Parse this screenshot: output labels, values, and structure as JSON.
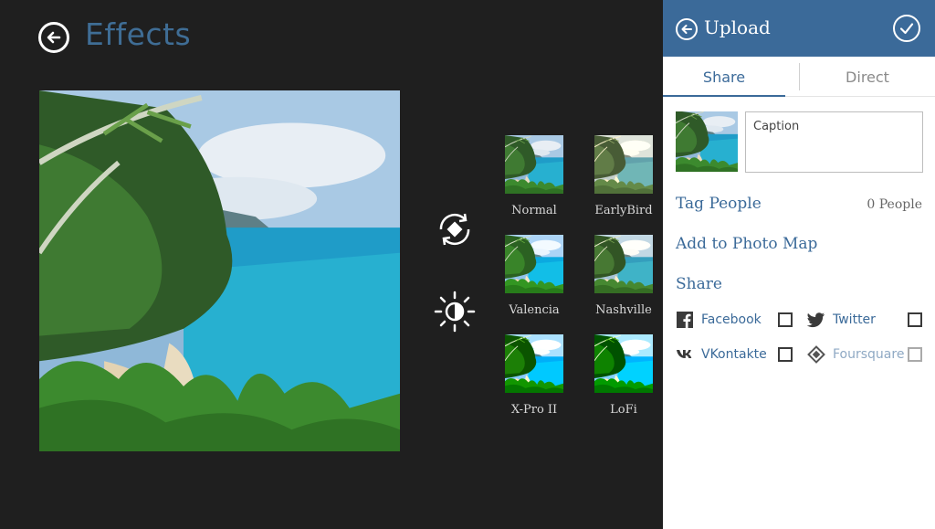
{
  "effects": {
    "title": "Effects",
    "filters": [
      {
        "name": "Normal"
      },
      {
        "name": "EarlyBird"
      },
      {
        "name": "Valencia"
      },
      {
        "name": "Nashville"
      },
      {
        "name": "X-Pro II"
      },
      {
        "name": "LoFi"
      }
    ]
  },
  "upload": {
    "title": "Upload",
    "tabs": [
      "Share",
      "Direct"
    ],
    "active_tab": "Share",
    "caption_placeholder": "Caption",
    "tag_people": "Tag People",
    "tag_count": "0 People",
    "add_to_map": "Add to Photo Map",
    "share_label": "Share",
    "networks": [
      {
        "name": "Facebook",
        "icon": "facebook-icon",
        "checked": false,
        "enabled": true
      },
      {
        "name": "Twitter",
        "icon": "twitter-icon",
        "checked": false,
        "enabled": true
      },
      {
        "name": "VKontakte",
        "icon": "vkontakte-icon",
        "checked": false,
        "enabled": true
      },
      {
        "name": "Foursquare",
        "icon": "foursquare-icon",
        "checked": false,
        "enabled": false
      }
    ]
  },
  "colors": {
    "accent": "#3b6a99",
    "background": "#1f1f1f",
    "panel": "#ffffff"
  }
}
